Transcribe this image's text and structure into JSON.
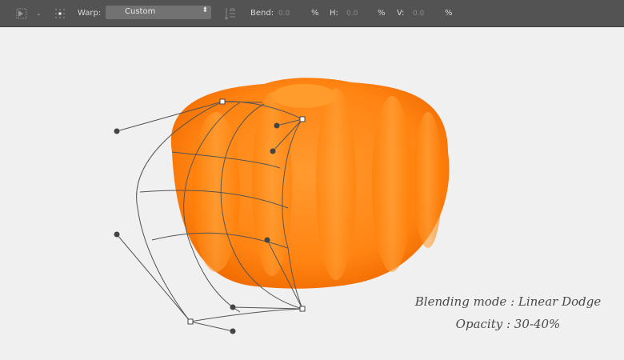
{
  "toolbar": {
    "warp_label": "Warp:",
    "warp_value": "Custom",
    "bend_label": "Bend:",
    "bend_value": "0.0",
    "bend_unit": "%",
    "h_label": "H:",
    "h_value": "0.0",
    "h_unit": "%",
    "v_label": "V:",
    "v_value": "0.0",
    "v_unit": "%",
    "icons": [
      "transform-tool-icon",
      "chevron-down-icon",
      "reference-point-icon",
      "warp-orientation-icon"
    ]
  },
  "caption": {
    "line1": "Blending mode : Linear Dodge",
    "line2": "Opacity : 30-40%"
  },
  "colors": {
    "toolbar": "#535353",
    "canvas": "#f0f0f0",
    "pumpkin": "#ff8a1a"
  }
}
